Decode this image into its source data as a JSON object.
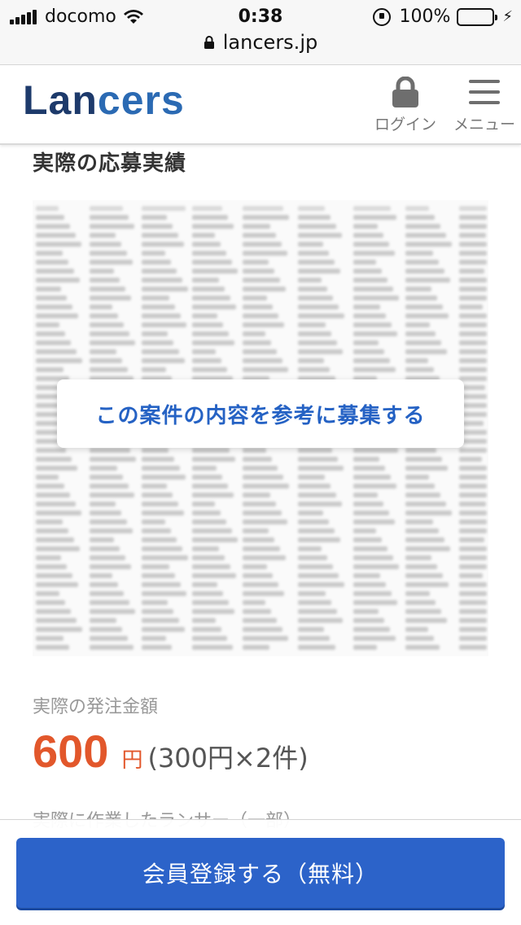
{
  "status_bar": {
    "carrier": "docomo",
    "time": "0:38",
    "battery": "100%",
    "url": "lancers.jp"
  },
  "header": {
    "logo_dark": "Lan",
    "logo_blue": "cers",
    "login_label": "ログイン",
    "menu_label": "メニュー"
  },
  "main": {
    "section_title": "実際の応募実績",
    "cta_label": "この案件の内容を参考に募集する",
    "amount_label": "実際の発注金額",
    "amount_value": "600",
    "amount_unit": "円",
    "amount_detail": "(300円×2件)",
    "cut_text": "実際に作業したランサー（一部）"
  },
  "footer": {
    "signup_label": "会員登録する（無料）"
  },
  "colors": {
    "brand_dark": "#1d3a6b",
    "brand_blue": "#2b6ab3",
    "accent_orange": "#e2572b",
    "button_blue": "#2c63c9"
  }
}
